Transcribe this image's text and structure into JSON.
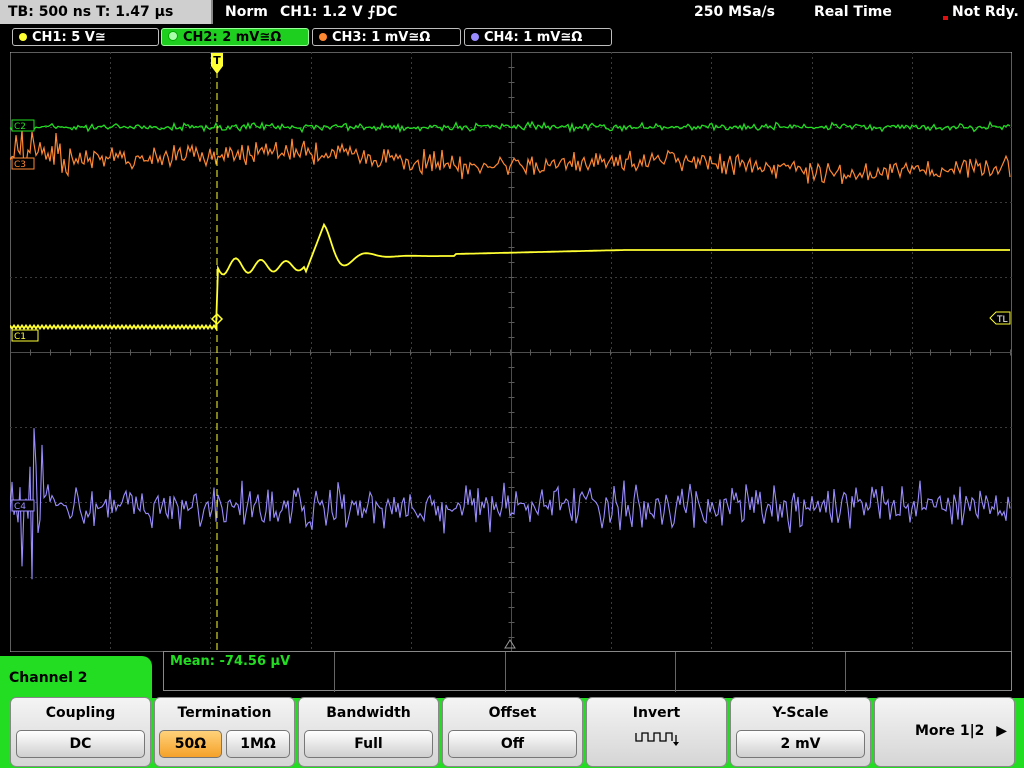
{
  "topbar": {
    "tb_label": "TB: 500 ns   T: 1.47 µs",
    "mode": "Norm",
    "trigger": "CH1: 1.2 V ⨍DC",
    "sample_rate": "250 MSa/s",
    "acq": "Real Time",
    "status": "Not Rdy."
  },
  "channels": [
    {
      "label": "CH1: 5 V≅",
      "color": "#ffff33"
    },
    {
      "label": "CH2: 2 mV≅Ω",
      "color": "#22dd22"
    },
    {
      "label": "CH3: 1 mV≅Ω",
      "color": "#ff8833"
    },
    {
      "label": "CH4: 1 mV≅Ω",
      "color": "#9a8cff"
    }
  ],
  "markers": {
    "c2": "C2",
    "c3": "C3",
    "c1": "C1",
    "c4": "C4",
    "tl": "TL",
    "trigger": "T"
  },
  "measurement": {
    "mean": "Mean: -74.56 µV"
  },
  "panel": {
    "title": "Channel 2"
  },
  "softkeys": [
    {
      "title": "Coupling",
      "value": "DC"
    },
    {
      "title": "Termination",
      "option_a": "50Ω",
      "option_b": "1MΩ",
      "active": "option_a"
    },
    {
      "title": "Bandwidth",
      "value": "Full"
    },
    {
      "title": "Offset",
      "value": "Off"
    },
    {
      "title": "Invert",
      "icon": "invert-square-wave-icon"
    },
    {
      "title": "Y-Scale",
      "value": "2 mV"
    },
    {
      "title": "More 1|2",
      "icon": "right-arrow-icon"
    }
  ]
}
